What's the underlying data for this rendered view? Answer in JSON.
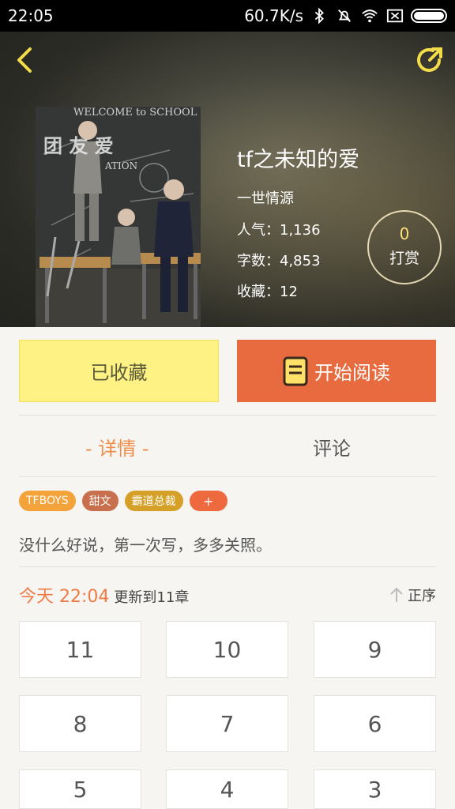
{
  "status_bar": {
    "time": "22:05",
    "speed": "60.7K/s"
  },
  "book": {
    "title": "tf之未知的爱",
    "author": "一世情源",
    "popularity": "人气：1,136",
    "words": "字数：4,853",
    "favorites": "收藏：12"
  },
  "cover": {
    "text1": "WELCOME to SCHOOL",
    "text2": "团  友  爱",
    "text3": "ATION"
  },
  "reward": {
    "count": "0",
    "label": "打赏"
  },
  "actions": {
    "favorited_label": "已收藏",
    "read_label": "开始阅读"
  },
  "tabs": {
    "detail": "- 详情 -",
    "comment": "评论"
  },
  "tags": [
    {
      "label": "TFBOYS",
      "color": "#f3a33a"
    },
    {
      "label": "甜文",
      "color": "#c8704e"
    },
    {
      "label": "霸道总裁",
      "color": "#d4a028"
    },
    {
      "label": "+",
      "color": "#ee6a3e"
    }
  ],
  "description": "没什么好说，第一次写，多多关照。",
  "update": {
    "time": "今天 22:04",
    "text": "更新到11章",
    "order_label": "正序"
  },
  "chapters": [
    "11",
    "10",
    "9",
    "8",
    "7",
    "6",
    "5",
    "4",
    "3"
  ]
}
